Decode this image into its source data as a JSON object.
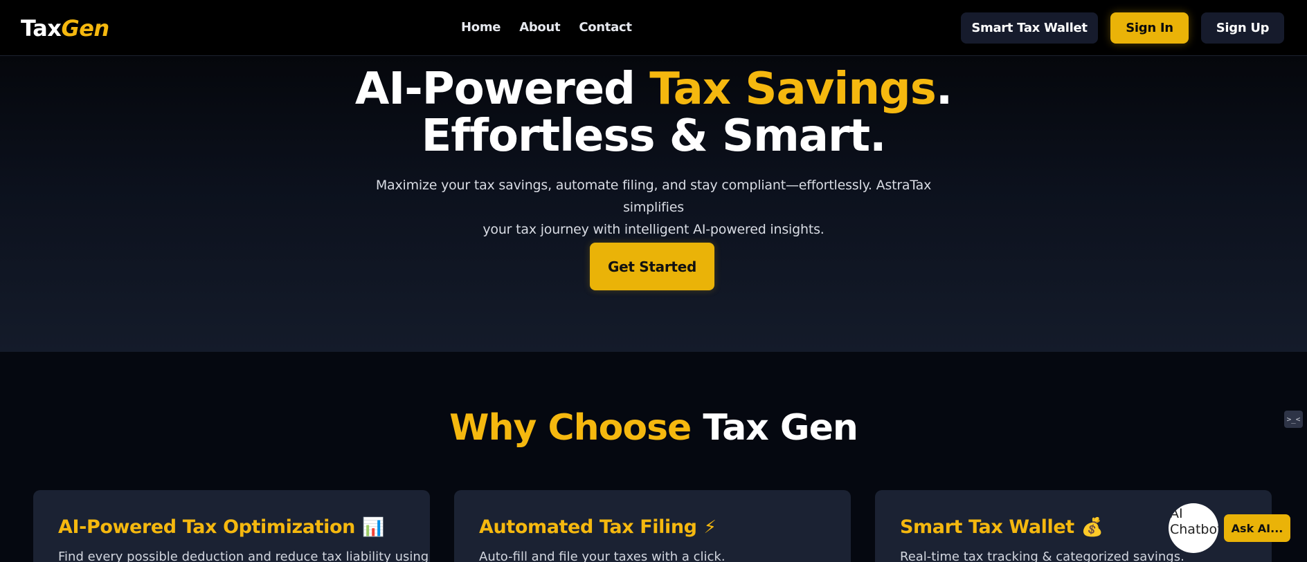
{
  "nav": {
    "logo_part1": "Tax",
    "logo_part2": "Gen",
    "links": [
      "Home",
      "About",
      "Contact"
    ],
    "smart_wallet_label": "Smart Tax Wallet",
    "signin_label": "Sign In",
    "signup_label": "Sign Up"
  },
  "hero": {
    "title_part1": "AI-Powered ",
    "title_highlight": "Tax Savings",
    "title_part2": ".",
    "title_line2": "Effortless & Smart.",
    "subtitle_line1": "Maximize your tax savings, automate filing, and stay compliant—effortlessly. AstraTax simplifies",
    "subtitle_line2": "your tax journey with intelligent AI-powered insights.",
    "cta_label": "Get Started"
  },
  "why": {
    "title_highlight": "Why Choose",
    "title_rest": " Tax Gen"
  },
  "cards": [
    {
      "title": "AI-Powered Tax Optimization",
      "emoji": "📊",
      "desc": "Find every possible deduction and reduce tax liability using AI."
    },
    {
      "title": "Automated Tax Filing",
      "emoji": "⚡",
      "desc": "Auto-fill and file your taxes with a click."
    },
    {
      "title": "Smart Tax Wallet",
      "emoji": "💰",
      "desc": "Real-time tax tracking & categorized savings."
    }
  ],
  "chat": {
    "side_tab_glyph": ">_<",
    "chatbot_alt": "AI Chatbot",
    "ask_label": "Ask AI..."
  },
  "colors": {
    "accent": "#eab308",
    "highlight_text": "#f5b80f",
    "background": "#050810",
    "card": "#1b2233"
  }
}
